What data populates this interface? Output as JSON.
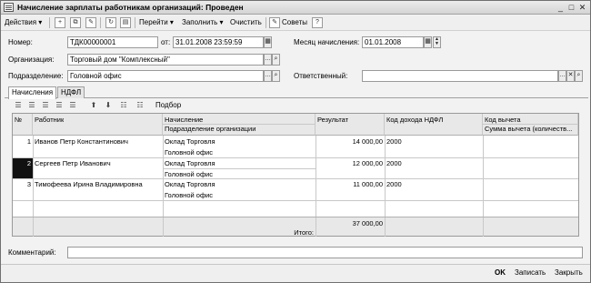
{
  "window": {
    "title": "Начисление зарплаты работникам организаций: Проведен"
  },
  "toolbar": {
    "actions_label": "Действия",
    "go_label": "Перейти",
    "fill_label": "Заполнить",
    "clear_label": "Очистить",
    "tips_label": "Советы",
    "help_label": "?"
  },
  "form": {
    "number_label": "Номер:",
    "number_value": "ТДК00000001",
    "from_label": "от:",
    "date_value": "31.01.2008 23:59:59",
    "month_label": "Месяц начисления:",
    "month_value": "01.01.2008",
    "org_label": "Организация:",
    "org_value": "Торговый дом \"Комплексный\"",
    "dept_label": "Подразделение:",
    "dept_value": "Головной офис",
    "responsible_label": "Ответственный:",
    "responsible_value": ""
  },
  "tabs": [
    {
      "label": "Начисления"
    },
    {
      "label": "НДФЛ"
    }
  ],
  "table_toolbar": {
    "selection_label": "Подбор"
  },
  "table": {
    "headers": {
      "num": "№",
      "employee": "Работник",
      "accrual": "Начисление",
      "dept": "Подразделение организации",
      "result": "Результат",
      "income_code": "Код дохода НДФЛ",
      "deduction_code": "Код вычета",
      "deduction_sum": "Сумма вычета (количеств..."
    },
    "rows": [
      {
        "num": "1",
        "employee": "Иванов  Петр  Константинович",
        "accrual": "Оклад Торговля",
        "dept": "Головной офис",
        "result": "14 000,00",
        "income_code": "2000"
      },
      {
        "num": "2",
        "employee": "Сергеев Петр Иванович",
        "accrual": "Оклад Торговля",
        "dept": "Головной офис",
        "result": "12 000,00",
        "income_code": "2000"
      },
      {
        "num": "3",
        "employee": "Тимофеева Ирина Владимировна",
        "accrual": "Оклад Торговля",
        "dept": "Головной офис",
        "result": "11 000,00",
        "income_code": "2000"
      }
    ],
    "total_value": "37 000,00",
    "total_label": "Итого:"
  },
  "comment": {
    "label": "Комментарий:",
    "value": ""
  },
  "buttons": {
    "ok": "OK",
    "save": "Записать",
    "close": "Закрыть"
  }
}
